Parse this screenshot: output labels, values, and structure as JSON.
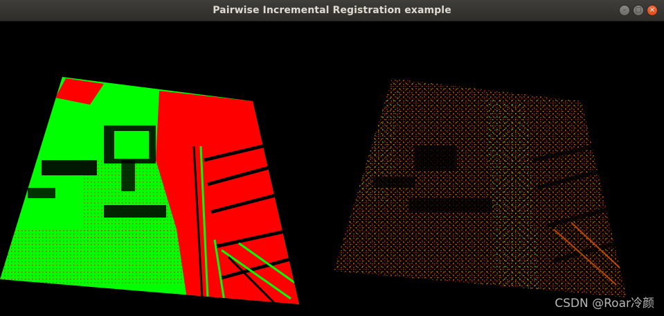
{
  "window": {
    "title": "Pairwise Incremental Registration example",
    "controls": {
      "minimize_glyph": "–",
      "maximize_glyph": "□",
      "close_glyph": "×"
    }
  },
  "viewports": {
    "left": {
      "description_icon": "point-cloud-overlay",
      "colors": [
        "#00ff00",
        "#ff0000"
      ]
    },
    "right": {
      "description_icon": "point-cloud-curvature",
      "colors": [
        "#ff2a00",
        "#ffcc00",
        "#00cc66"
      ]
    }
  },
  "watermark": {
    "text": "CSDN @Roar冷颜"
  },
  "colors": {
    "titlebar": "#3a3935",
    "close": "#e9541f",
    "background": "#000000"
  }
}
